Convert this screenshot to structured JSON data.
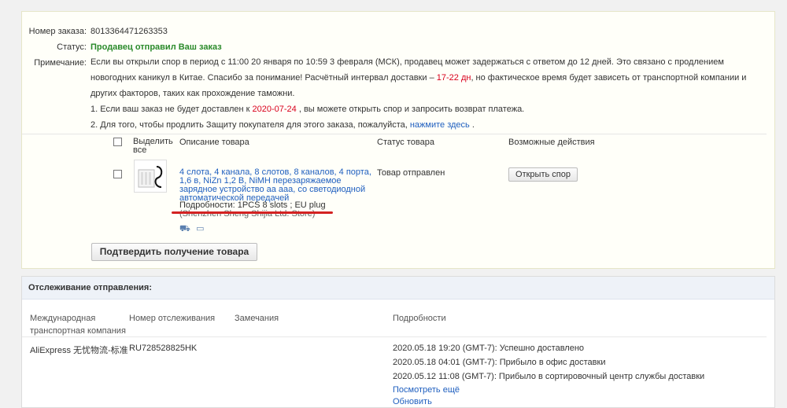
{
  "order": {
    "number_label": "Номер заказа:",
    "number": "8013364471263353",
    "status_label": "Статус:",
    "status": "Продавец отправил Ваш заказ",
    "note_label": "Примечание:",
    "note_part1": "Если вы открыли спор в период с 11:00 20 января по 10:59 3 февраля (МСК), продавец может задержаться с ответом до 12 дней. Это связано с продлением новогодних каникул в Китае. Спасибо за понимание! Расчётный интервал доставки – ",
    "note_days": "17-22 дн",
    "note_part2": ", но фактическое время будет зависеть от транспортной компании и других факторов, таких как прохождение таможни.",
    "item1_prefix": "1. Если ваш заказ не будет доставлен к ",
    "item1_date": "2020-07-24",
    "item1_suffix": " , вы можете открыть спор и запросить возврат платежа.",
    "item2_prefix": "2. Для того, чтобы продлить Защиту покупателя для этого заказа, пожалуйста, ",
    "item2_link": "нажмите здесь",
    "item2_suffix": " ."
  },
  "table": {
    "col_select": "Выделить все",
    "col_desc": "Описание товара",
    "col_status": "Статус товара",
    "col_actions": "Возможные действия"
  },
  "product": {
    "title": "4 слота, 4 канала, 8 слотов, 8 каналов, 4 порта, 1,6 в, NiZn 1,2 В, NiMH перезаряжаемое зарядное устройство аа ааа, со светодиодной автоматической передачей",
    "details": "Подробности: 1PCS 8 slots   ; EU plug",
    "store": "(Shenzhen Sheng Shijia Ltd. Store)",
    "status": "Товар отправлен",
    "dispute_button": "Открыть спор",
    "icons": [
      "truck-icon",
      "card-icon"
    ]
  },
  "confirm_button": "Подтвердить получение товара",
  "tracking": {
    "title": "Отслеживание отправления:",
    "col_carrier": "Международная транспортная компания",
    "col_number": "Номер отслеживания",
    "col_remarks": "Замечания",
    "col_details": "Подробности",
    "carrier": "AliExpress 无忧物流-标准",
    "number": "RU728528825HK",
    "events": [
      "2020.05.18 19:20 (GMT-7): Успешно доставлено",
      "2020.05.18 04:01 (GMT-7): Прибыло в офис доставки",
      "2020.05.12 11:08 (GMT-7): Прибыло в сортировочный центр службы доставки"
    ],
    "more_link": "Посмотреть ещё",
    "refresh_link": "Обновить"
  }
}
